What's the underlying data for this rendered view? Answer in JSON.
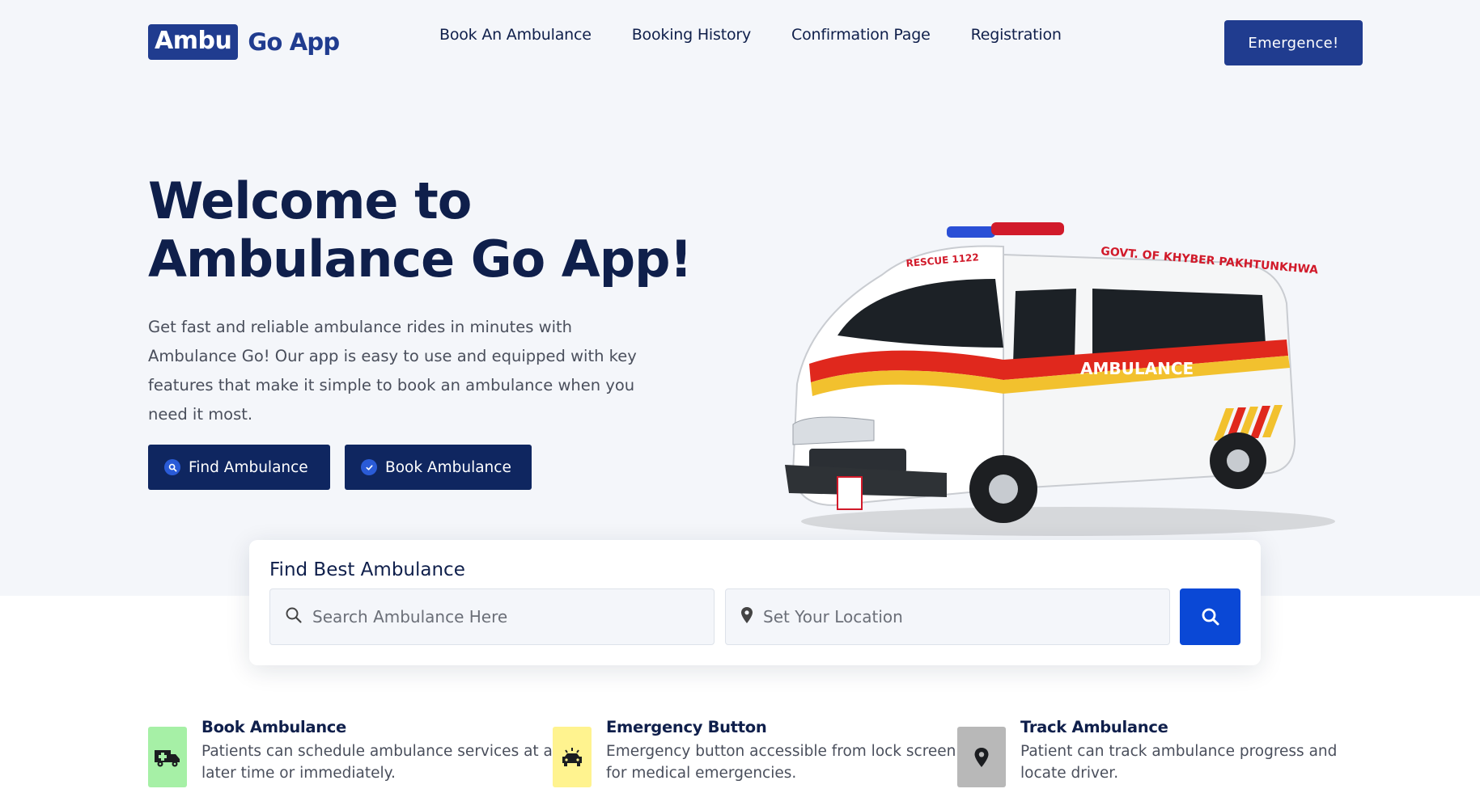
{
  "header": {
    "logo_box": "Ambu",
    "logo_text": "Go App",
    "nav": [
      {
        "label": "Book An Ambulance"
      },
      {
        "label": "Booking History"
      },
      {
        "label": "Confirmation Page"
      },
      {
        "label": "Registration"
      }
    ],
    "emergency_button": "Emergence!"
  },
  "hero": {
    "title_line1": "Welcome to",
    "title_line2": "Ambulance Go App!",
    "description": "Get fast and reliable ambulance rides in minutes with Ambulance Go! Our app is easy to use and equipped with key features that make it simple to book an ambulance when you need it most.",
    "find_button": "Find Ambulance",
    "book_button": "Book Ambulance",
    "vehicle_text": {
      "rescue": "RESCUE 1122",
      "govt": "GOVT. OF KHYBER PAKHTUNKHWA",
      "ambulance": "AMBULANCE",
      "hood": "AMBULANCE"
    }
  },
  "search": {
    "title": "Find Best Ambulance",
    "search_placeholder": "Search Ambulance Here",
    "location_placeholder": "Set Your Location"
  },
  "features": [
    {
      "title": "Book Ambulance",
      "description": "Patients can schedule ambulance services at a later time or immediately.",
      "icon": "ambulance-icon",
      "color": "#a6f0a6"
    },
    {
      "title": "Emergency Button",
      "description": "Emergency button accessible from lock screen for medical emergencies.",
      "icon": "emergency-car-icon",
      "color": "#fff38f"
    },
    {
      "title": "Track Ambulance",
      "description": "Patient can track ambulance progress and locate driver.",
      "icon": "map-pin-icon",
      "color": "#b8b8b8"
    }
  ],
  "colors": {
    "brand": "#203c8f",
    "dark_button": "#0f2660",
    "search_button": "#0a48d6",
    "hero_background": "#f4f6fa"
  }
}
